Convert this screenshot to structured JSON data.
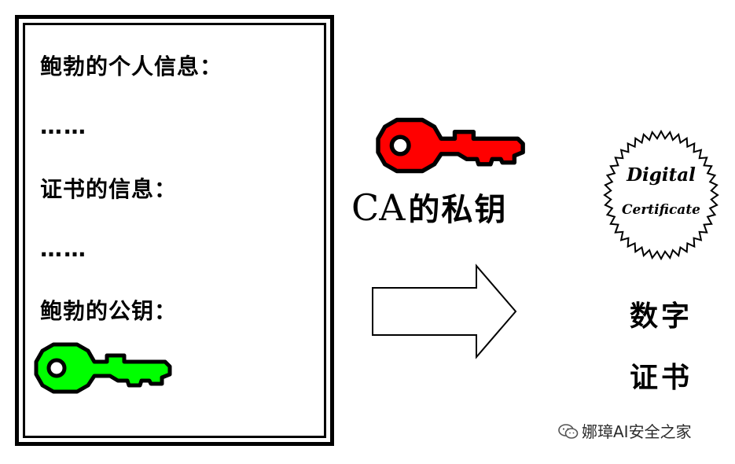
{
  "card": {
    "personal_info_label": "鲍勃的个人信息：",
    "personal_info_value": "……",
    "cert_info_label": "证书的信息：",
    "cert_info_value": "……",
    "public_key_label": "鲍勃的公钥："
  },
  "issuer": {
    "abbr": "CA",
    "text": "的私钥"
  },
  "seal": {
    "line1": "Digital",
    "line2": "Certificate"
  },
  "result": {
    "line1": "数字",
    "line2": "证书"
  },
  "watermark": {
    "text": "娜璋AI安全之家"
  },
  "colors": {
    "public_key": "#00ff00",
    "private_key": "#ff0000",
    "outline": "#000000"
  },
  "icons": {
    "public_key": "key-icon",
    "private_key": "key-icon",
    "arrow": "arrow-right-icon",
    "seal": "certificate-seal-icon",
    "watermark": "wechat-icon"
  }
}
